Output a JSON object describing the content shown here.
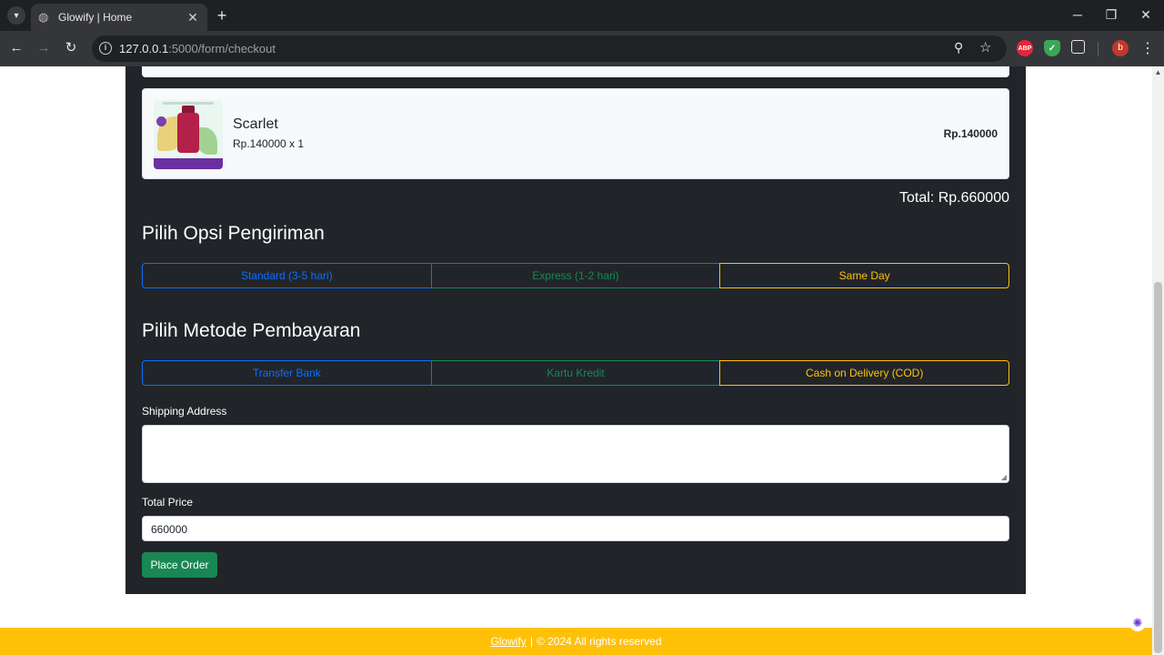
{
  "browser": {
    "tab_title": "Glowify | Home",
    "url_host": "127.0.0.1",
    "url_rest": ":5000/form/checkout",
    "profile_initial": "b",
    "extensions": [
      "ABP"
    ]
  },
  "cart": {
    "item": {
      "name": "Scarlet",
      "qty_line": "Rp.140000 x 1",
      "price": "Rp.140000"
    },
    "total": "Total: Rp.660000"
  },
  "shipping": {
    "heading": "Pilih Opsi Pengiriman",
    "options": [
      "Standard (3-5 hari)",
      "Express (1-2 hari)",
      "Same Day"
    ]
  },
  "payment": {
    "heading": "Pilih Metode Pembayaran",
    "options": [
      "Transfer Bank",
      "Kartu Kredit",
      "Cash on Delivery (COD)"
    ]
  },
  "form": {
    "address_label": "Shipping Address",
    "address_value": "",
    "total_label": "Total Price",
    "total_value": "660000",
    "submit_label": "Place Order"
  },
  "footer": {
    "brand": "Glowify",
    "separator": "|",
    "copyright": "© 2024 All rights reserved"
  },
  "colors": {
    "panel": "#212529",
    "primary": "#0d6efd",
    "success": "#198754",
    "warning": "#ffc107"
  }
}
